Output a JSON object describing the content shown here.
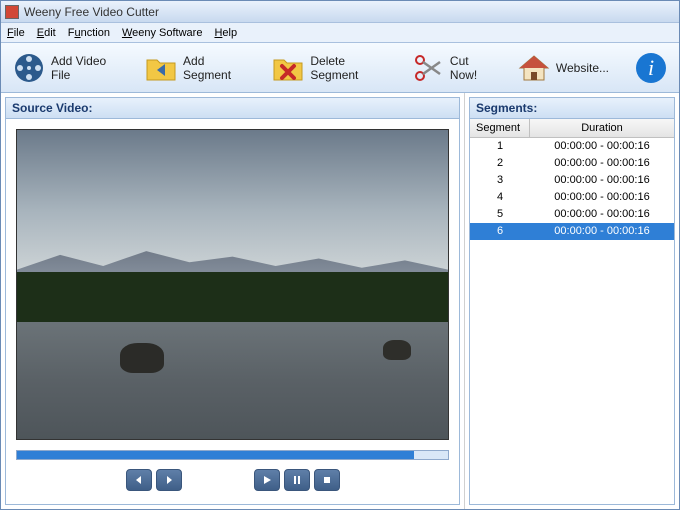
{
  "title": "Weeny Free Video Cutter",
  "menu": {
    "file": "File",
    "edit": "Edit",
    "function": "Function",
    "software": "Weeny Software",
    "help": "Help"
  },
  "toolbar": {
    "addVideo": "Add Video File",
    "addSegment": "Add Segment",
    "delSegment": "Delete Segment",
    "cutNow": "Cut Now!",
    "website": "Website..."
  },
  "panels": {
    "source": "Source Video:",
    "segments": "Segments:"
  },
  "segmentsTable": {
    "headers": {
      "seg": "Segment",
      "dur": "Duration"
    },
    "rows": [
      {
        "id": "1",
        "dur": "00:00:00 - 00:00:16",
        "sel": false
      },
      {
        "id": "2",
        "dur": "00:00:00 - 00:00:16",
        "sel": false
      },
      {
        "id": "3",
        "dur": "00:00:00 - 00:00:16",
        "sel": false
      },
      {
        "id": "4",
        "dur": "00:00:00 - 00:00:16",
        "sel": false
      },
      {
        "id": "5",
        "dur": "00:00:00 - 00:00:16",
        "sel": false
      },
      {
        "id": "6",
        "dur": "00:00:00 - 00:00:16",
        "sel": true
      }
    ]
  }
}
